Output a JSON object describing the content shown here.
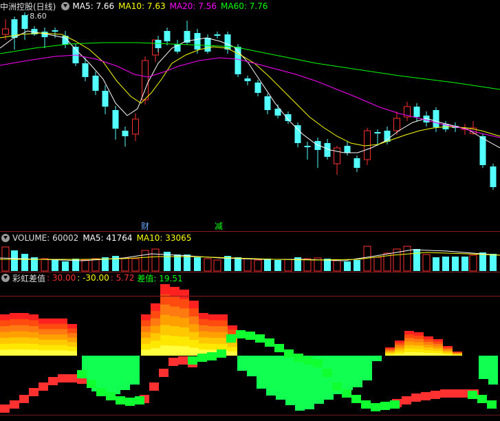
{
  "price_panel": {
    "title": "中洲控股(日线)",
    "ma5": {
      "label": "MA5:",
      "value": "7.66",
      "color": "#ffffff"
    },
    "ma10": {
      "label": "MA10:",
      "value": "7.63",
      "color": "#ffff00"
    },
    "ma20": {
      "label": "MA20:",
      "value": "7.56",
      "color": "#ff00ff"
    },
    "ma60": {
      "label": "MA60:",
      "value": "7.76",
      "color": "#00ff00"
    },
    "high_marker": "8.60",
    "event_markers": [
      {
        "text": "财",
        "color": "#66aaff"
      },
      {
        "text": "减",
        "color": "#00ff00"
      }
    ]
  },
  "volume_panel": {
    "title": "VOLUME:",
    "value": "60002",
    "ma5": {
      "label": "MA5:",
      "value": "41764"
    },
    "ma10": {
      "label": "MA10:",
      "value": "33065"
    }
  },
  "rainbow_panel": {
    "title": "彩虹差值",
    "v1": ": 30.00",
    "v2": ": -30.00",
    "v3": ": 5.72",
    "diff_label": "差值:",
    "diff_value": "19.51"
  },
  "colors": {
    "up": "#ff3030",
    "down": "#54ffff",
    "grid": "#8b1a1a"
  }
}
